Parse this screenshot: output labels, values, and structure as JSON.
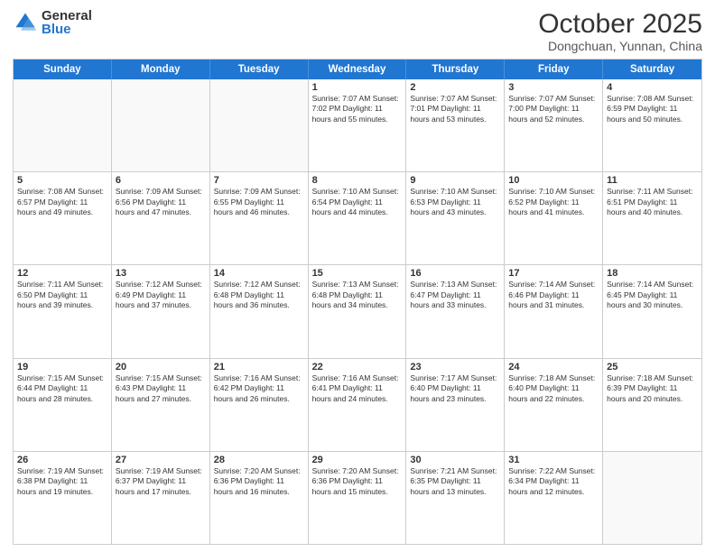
{
  "logo": {
    "general": "General",
    "blue": "Blue"
  },
  "header": {
    "month": "October 2025",
    "location": "Dongchuan, Yunnan, China"
  },
  "weekdays": [
    "Sunday",
    "Monday",
    "Tuesday",
    "Wednesday",
    "Thursday",
    "Friday",
    "Saturday"
  ],
  "rows": [
    [
      {
        "day": "",
        "info": ""
      },
      {
        "day": "",
        "info": ""
      },
      {
        "day": "",
        "info": ""
      },
      {
        "day": "1",
        "info": "Sunrise: 7:07 AM\nSunset: 7:02 PM\nDaylight: 11 hours and 55 minutes."
      },
      {
        "day": "2",
        "info": "Sunrise: 7:07 AM\nSunset: 7:01 PM\nDaylight: 11 hours and 53 minutes."
      },
      {
        "day": "3",
        "info": "Sunrise: 7:07 AM\nSunset: 7:00 PM\nDaylight: 11 hours and 52 minutes."
      },
      {
        "day": "4",
        "info": "Sunrise: 7:08 AM\nSunset: 6:59 PM\nDaylight: 11 hours and 50 minutes."
      }
    ],
    [
      {
        "day": "5",
        "info": "Sunrise: 7:08 AM\nSunset: 6:57 PM\nDaylight: 11 hours and 49 minutes."
      },
      {
        "day": "6",
        "info": "Sunrise: 7:09 AM\nSunset: 6:56 PM\nDaylight: 11 hours and 47 minutes."
      },
      {
        "day": "7",
        "info": "Sunrise: 7:09 AM\nSunset: 6:55 PM\nDaylight: 11 hours and 46 minutes."
      },
      {
        "day": "8",
        "info": "Sunrise: 7:10 AM\nSunset: 6:54 PM\nDaylight: 11 hours and 44 minutes."
      },
      {
        "day": "9",
        "info": "Sunrise: 7:10 AM\nSunset: 6:53 PM\nDaylight: 11 hours and 43 minutes."
      },
      {
        "day": "10",
        "info": "Sunrise: 7:10 AM\nSunset: 6:52 PM\nDaylight: 11 hours and 41 minutes."
      },
      {
        "day": "11",
        "info": "Sunrise: 7:11 AM\nSunset: 6:51 PM\nDaylight: 11 hours and 40 minutes."
      }
    ],
    [
      {
        "day": "12",
        "info": "Sunrise: 7:11 AM\nSunset: 6:50 PM\nDaylight: 11 hours and 39 minutes."
      },
      {
        "day": "13",
        "info": "Sunrise: 7:12 AM\nSunset: 6:49 PM\nDaylight: 11 hours and 37 minutes."
      },
      {
        "day": "14",
        "info": "Sunrise: 7:12 AM\nSunset: 6:48 PM\nDaylight: 11 hours and 36 minutes."
      },
      {
        "day": "15",
        "info": "Sunrise: 7:13 AM\nSunset: 6:48 PM\nDaylight: 11 hours and 34 minutes."
      },
      {
        "day": "16",
        "info": "Sunrise: 7:13 AM\nSunset: 6:47 PM\nDaylight: 11 hours and 33 minutes."
      },
      {
        "day": "17",
        "info": "Sunrise: 7:14 AM\nSunset: 6:46 PM\nDaylight: 11 hours and 31 minutes."
      },
      {
        "day": "18",
        "info": "Sunrise: 7:14 AM\nSunset: 6:45 PM\nDaylight: 11 hours and 30 minutes."
      }
    ],
    [
      {
        "day": "19",
        "info": "Sunrise: 7:15 AM\nSunset: 6:44 PM\nDaylight: 11 hours and 28 minutes."
      },
      {
        "day": "20",
        "info": "Sunrise: 7:15 AM\nSunset: 6:43 PM\nDaylight: 11 hours and 27 minutes."
      },
      {
        "day": "21",
        "info": "Sunrise: 7:16 AM\nSunset: 6:42 PM\nDaylight: 11 hours and 26 minutes."
      },
      {
        "day": "22",
        "info": "Sunrise: 7:16 AM\nSunset: 6:41 PM\nDaylight: 11 hours and 24 minutes."
      },
      {
        "day": "23",
        "info": "Sunrise: 7:17 AM\nSunset: 6:40 PM\nDaylight: 11 hours and 23 minutes."
      },
      {
        "day": "24",
        "info": "Sunrise: 7:18 AM\nSunset: 6:40 PM\nDaylight: 11 hours and 22 minutes."
      },
      {
        "day": "25",
        "info": "Sunrise: 7:18 AM\nSunset: 6:39 PM\nDaylight: 11 hours and 20 minutes."
      }
    ],
    [
      {
        "day": "26",
        "info": "Sunrise: 7:19 AM\nSunset: 6:38 PM\nDaylight: 11 hours and 19 minutes."
      },
      {
        "day": "27",
        "info": "Sunrise: 7:19 AM\nSunset: 6:37 PM\nDaylight: 11 hours and 17 minutes."
      },
      {
        "day": "28",
        "info": "Sunrise: 7:20 AM\nSunset: 6:36 PM\nDaylight: 11 hours and 16 minutes."
      },
      {
        "day": "29",
        "info": "Sunrise: 7:20 AM\nSunset: 6:36 PM\nDaylight: 11 hours and 15 minutes."
      },
      {
        "day": "30",
        "info": "Sunrise: 7:21 AM\nSunset: 6:35 PM\nDaylight: 11 hours and 13 minutes."
      },
      {
        "day": "31",
        "info": "Sunrise: 7:22 AM\nSunset: 6:34 PM\nDaylight: 11 hours and 12 minutes."
      },
      {
        "day": "",
        "info": ""
      }
    ]
  ]
}
